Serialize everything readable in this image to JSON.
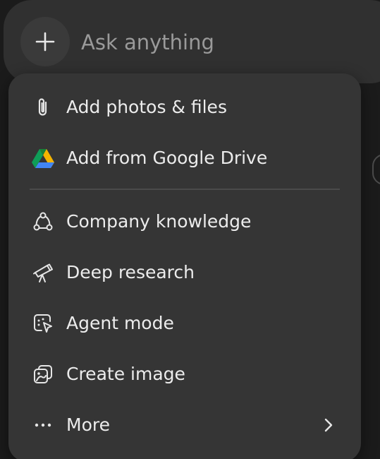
{
  "composer": {
    "add_icon": "plus-icon",
    "placeholder": "Ask anything"
  },
  "menu": {
    "items": [
      {
        "label": "Add photos & files",
        "icon": "paperclip-icon"
      },
      {
        "label": "Add from Google Drive",
        "icon": "google-drive-icon"
      },
      {
        "label": "Company knowledge",
        "icon": "connections-icon"
      },
      {
        "label": "Deep research",
        "icon": "telescope-icon"
      },
      {
        "label": "Agent mode",
        "icon": "agent-icon"
      },
      {
        "label": "Create image",
        "icon": "image-create-icon"
      },
      {
        "label": "More",
        "icon": "more-dots-icon",
        "submenu_icon": "chevron-right-icon"
      }
    ]
  },
  "colors": {
    "background": "#1b1b1b",
    "composer": "#303030",
    "menu": "#353535",
    "text": "#ececec",
    "placeholder": "#9a9a9a",
    "drive_green": "#0f9d58",
    "drive_yellow": "#f4b400",
    "drive_blue": "#4285f4"
  }
}
